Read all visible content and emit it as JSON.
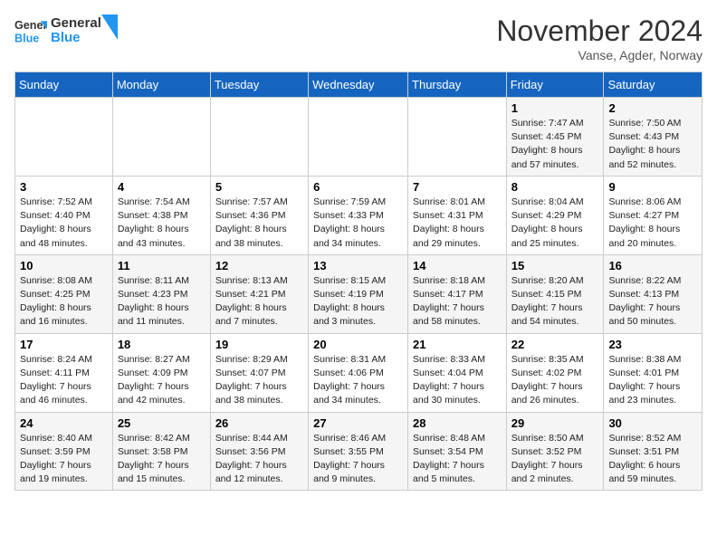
{
  "logo": {
    "text_general": "General",
    "text_blue": "Blue"
  },
  "header": {
    "month": "November 2024",
    "location": "Vanse, Agder, Norway"
  },
  "weekdays": [
    "Sunday",
    "Monday",
    "Tuesday",
    "Wednesday",
    "Thursday",
    "Friday",
    "Saturday"
  ],
  "weeks": [
    [
      {
        "day": "",
        "info": ""
      },
      {
        "day": "",
        "info": ""
      },
      {
        "day": "",
        "info": ""
      },
      {
        "day": "",
        "info": ""
      },
      {
        "day": "",
        "info": ""
      },
      {
        "day": "1",
        "info": "Sunrise: 7:47 AM\nSunset: 4:45 PM\nDaylight: 8 hours and 57 minutes."
      },
      {
        "day": "2",
        "info": "Sunrise: 7:50 AM\nSunset: 4:43 PM\nDaylight: 8 hours and 52 minutes."
      }
    ],
    [
      {
        "day": "3",
        "info": "Sunrise: 7:52 AM\nSunset: 4:40 PM\nDaylight: 8 hours and 48 minutes."
      },
      {
        "day": "4",
        "info": "Sunrise: 7:54 AM\nSunset: 4:38 PM\nDaylight: 8 hours and 43 minutes."
      },
      {
        "day": "5",
        "info": "Sunrise: 7:57 AM\nSunset: 4:36 PM\nDaylight: 8 hours and 38 minutes."
      },
      {
        "day": "6",
        "info": "Sunrise: 7:59 AM\nSunset: 4:33 PM\nDaylight: 8 hours and 34 minutes."
      },
      {
        "day": "7",
        "info": "Sunrise: 8:01 AM\nSunset: 4:31 PM\nDaylight: 8 hours and 29 minutes."
      },
      {
        "day": "8",
        "info": "Sunrise: 8:04 AM\nSunset: 4:29 PM\nDaylight: 8 hours and 25 minutes."
      },
      {
        "day": "9",
        "info": "Sunrise: 8:06 AM\nSunset: 4:27 PM\nDaylight: 8 hours and 20 minutes."
      }
    ],
    [
      {
        "day": "10",
        "info": "Sunrise: 8:08 AM\nSunset: 4:25 PM\nDaylight: 8 hours and 16 minutes."
      },
      {
        "day": "11",
        "info": "Sunrise: 8:11 AM\nSunset: 4:23 PM\nDaylight: 8 hours and 11 minutes."
      },
      {
        "day": "12",
        "info": "Sunrise: 8:13 AM\nSunset: 4:21 PM\nDaylight: 8 hours and 7 minutes."
      },
      {
        "day": "13",
        "info": "Sunrise: 8:15 AM\nSunset: 4:19 PM\nDaylight: 8 hours and 3 minutes."
      },
      {
        "day": "14",
        "info": "Sunrise: 8:18 AM\nSunset: 4:17 PM\nDaylight: 7 hours and 58 minutes."
      },
      {
        "day": "15",
        "info": "Sunrise: 8:20 AM\nSunset: 4:15 PM\nDaylight: 7 hours and 54 minutes."
      },
      {
        "day": "16",
        "info": "Sunrise: 8:22 AM\nSunset: 4:13 PM\nDaylight: 7 hours and 50 minutes."
      }
    ],
    [
      {
        "day": "17",
        "info": "Sunrise: 8:24 AM\nSunset: 4:11 PM\nDaylight: 7 hours and 46 minutes."
      },
      {
        "day": "18",
        "info": "Sunrise: 8:27 AM\nSunset: 4:09 PM\nDaylight: 7 hours and 42 minutes."
      },
      {
        "day": "19",
        "info": "Sunrise: 8:29 AM\nSunset: 4:07 PM\nDaylight: 7 hours and 38 minutes."
      },
      {
        "day": "20",
        "info": "Sunrise: 8:31 AM\nSunset: 4:06 PM\nDaylight: 7 hours and 34 minutes."
      },
      {
        "day": "21",
        "info": "Sunrise: 8:33 AM\nSunset: 4:04 PM\nDaylight: 7 hours and 30 minutes."
      },
      {
        "day": "22",
        "info": "Sunrise: 8:35 AM\nSunset: 4:02 PM\nDaylight: 7 hours and 26 minutes."
      },
      {
        "day": "23",
        "info": "Sunrise: 8:38 AM\nSunset: 4:01 PM\nDaylight: 7 hours and 23 minutes."
      }
    ],
    [
      {
        "day": "24",
        "info": "Sunrise: 8:40 AM\nSunset: 3:59 PM\nDaylight: 7 hours and 19 minutes."
      },
      {
        "day": "25",
        "info": "Sunrise: 8:42 AM\nSunset: 3:58 PM\nDaylight: 7 hours and 15 minutes."
      },
      {
        "day": "26",
        "info": "Sunrise: 8:44 AM\nSunset: 3:56 PM\nDaylight: 7 hours and 12 minutes."
      },
      {
        "day": "27",
        "info": "Sunrise: 8:46 AM\nSunset: 3:55 PM\nDaylight: 7 hours and 9 minutes."
      },
      {
        "day": "28",
        "info": "Sunrise: 8:48 AM\nSunset: 3:54 PM\nDaylight: 7 hours and 5 minutes."
      },
      {
        "day": "29",
        "info": "Sunrise: 8:50 AM\nSunset: 3:52 PM\nDaylight: 7 hours and 2 minutes."
      },
      {
        "day": "30",
        "info": "Sunrise: 8:52 AM\nSunset: 3:51 PM\nDaylight: 6 hours and 59 minutes."
      }
    ]
  ]
}
